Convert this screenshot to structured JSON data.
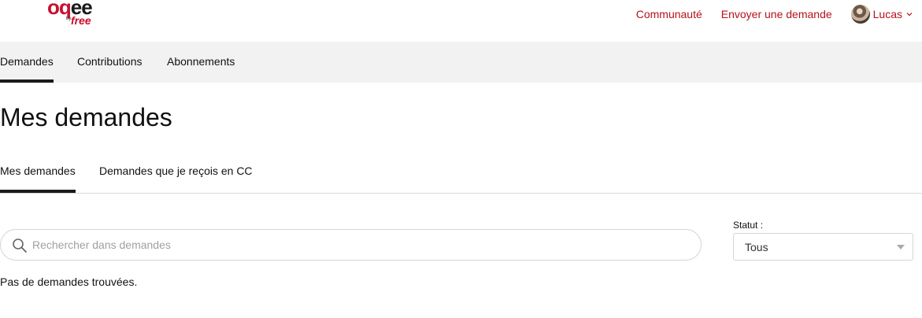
{
  "header": {
    "logo": {
      "main": "oqee",
      "by": "by",
      "brand": "free"
    },
    "nav": {
      "community": "Communauté",
      "submit_request": "Envoyer une demande",
      "user_name": "Lucas"
    }
  },
  "subnav": {
    "tabs": [
      {
        "label": "Demandes",
        "active": true
      },
      {
        "label": "Contributions",
        "active": false
      },
      {
        "label": "Abonnements",
        "active": false
      }
    ]
  },
  "main": {
    "title": "Mes demandes",
    "tabs": [
      {
        "label": "Mes demandes",
        "active": true
      },
      {
        "label": "Demandes que je reçois en CC",
        "active": false
      }
    ],
    "search": {
      "placeholder": "Rechercher dans demandes",
      "value": ""
    },
    "status": {
      "label": "Statut :",
      "selected": "Tous"
    },
    "empty_message": "Pas de demandes trouvées."
  },
  "colors": {
    "brand_red": "#b5121b",
    "active_underline": "#1a1a1a",
    "subnav_bg": "#f2f2f2"
  }
}
